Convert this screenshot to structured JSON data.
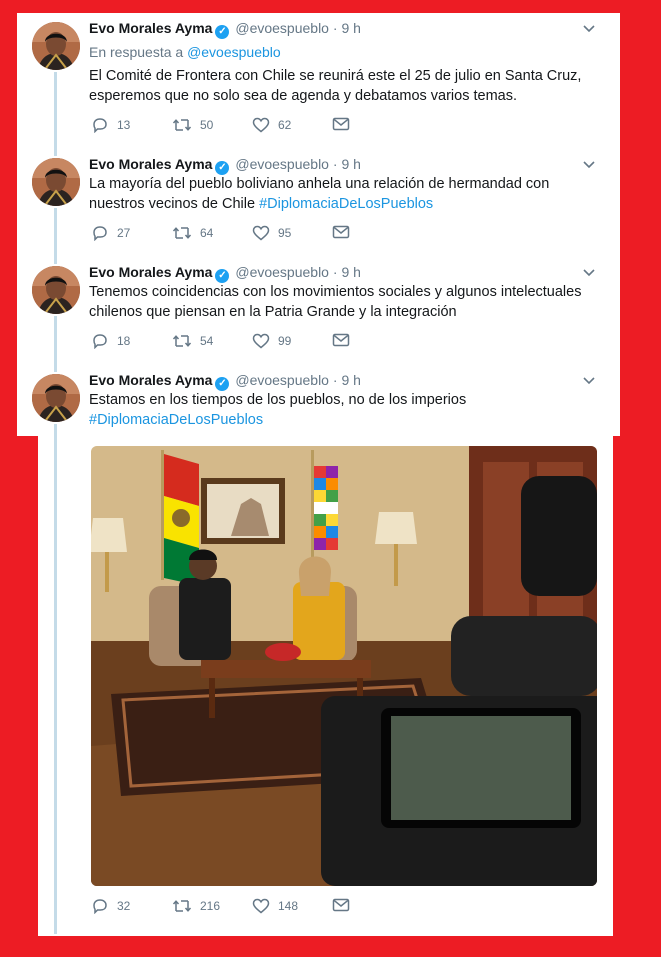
{
  "tweets": [
    {
      "name": "Evo Morales Ayma",
      "handle": "@evoespueblo",
      "time": "9 h",
      "reply_prefix": "En respuesta a",
      "reply_to": "@evoespueblo",
      "text": "El Comité de Frontera con Chile se reunirá este el 25 de julio en Santa Cruz, esperemos que no solo sea de agenda y debatamos varios temas.",
      "replies": "13",
      "retweets": "50",
      "likes": "62"
    },
    {
      "name": "Evo Morales Ayma",
      "handle": "@evoespueblo",
      "time": "9 h",
      "text": "La mayoría del pueblo boliviano anhela una relación de hermandad con nuestros vecinos de Chile",
      "hashtag": "#DiplomaciaDeLosPueblos",
      "replies": "27",
      "retweets": "64",
      "likes": "95"
    },
    {
      "name": "Evo Morales Ayma",
      "handle": "@evoespueblo",
      "time": "9 h",
      "text": "Tenemos coincidencias con los movimientos sociales y algunos intelectuales chilenos que piensan en la Patria Grande y la integración",
      "replies": "18",
      "retweets": "54",
      "likes": "99"
    },
    {
      "name": "Evo Morales Ayma",
      "handle": "@evoespueblo",
      "time": "9 h",
      "text": "Estamos en los tiempos de los pueblos, no de los imperios",
      "hashtag": "#DiplomaciaDeLosPueblos",
      "replies": "32",
      "retweets": "216",
      "likes": "148"
    }
  ],
  "colors": {
    "background": "#ed1c24",
    "link": "#1b95e0",
    "muted": "#657786",
    "thread_line": "#c4dbe8",
    "verified": "#1da1f2"
  },
  "icons": {
    "reply": "reply-icon",
    "retweet": "retweet-icon",
    "like": "heart-icon",
    "dm": "envelope-icon",
    "more": "chevron-down-icon",
    "verified": "verified-badge-icon"
  }
}
